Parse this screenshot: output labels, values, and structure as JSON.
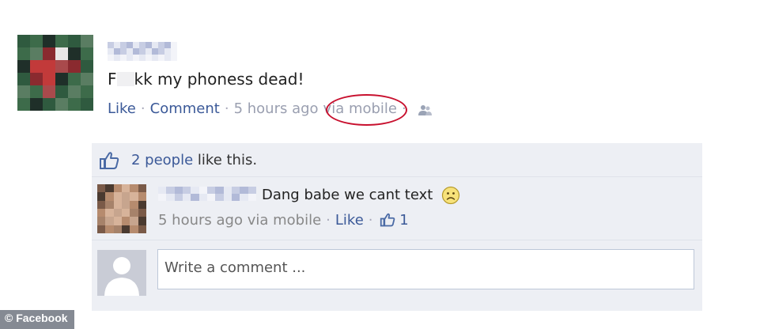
{
  "post": {
    "text_before": "F",
    "text_after": "kk my phoness dead!",
    "like_link": "Like",
    "comment_link": "Comment",
    "time": "5 hours ago",
    "via": "via mobile"
  },
  "ufi": {
    "likes_count": "2 people",
    "likes_suffix": " like this.",
    "comment": {
      "text": "Dang babe we cant text",
      "time": "5 hours ago via mobile",
      "like_link": "Like",
      "like_count": "1"
    },
    "composer": {
      "placeholder": "Write a comment ..."
    }
  },
  "watermark": "© Facebook",
  "colors": {
    "link": "#3b5998",
    "highlight_circle": "#c8102e",
    "ufi_background": "#edeff4"
  },
  "icons": [
    "thumbs-up-icon",
    "friends-audience-icon",
    "sad-emoticon-icon",
    "silhouette-avatar-icon"
  ]
}
